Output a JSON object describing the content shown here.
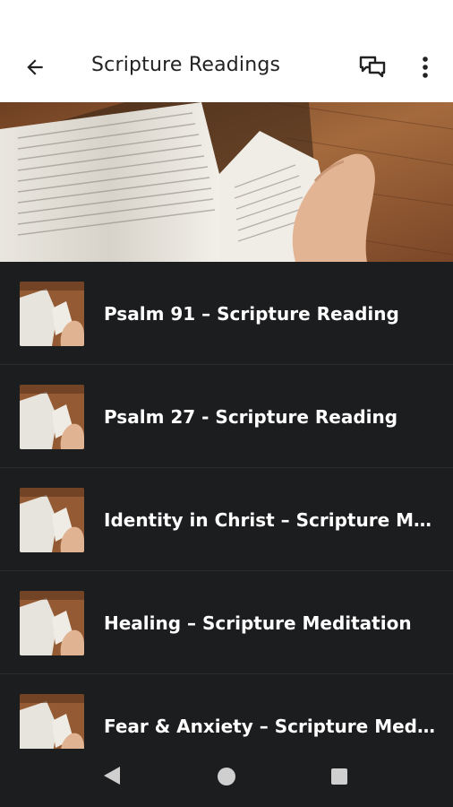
{
  "app_bar": {
    "title": "Scripture Readings",
    "back_icon": "arrow-back-icon",
    "chat_icon": "chat-bubbles-icon",
    "more_icon": "more-vert-icon"
  },
  "list": {
    "items": [
      {
        "title": "Psalm 91 – Scripture Reading"
      },
      {
        "title": "Psalm 27 - Scripture Reading"
      },
      {
        "title": "Identity in Christ – Scripture Meditation"
      },
      {
        "title": "Healing  – Scripture Meditation"
      },
      {
        "title": "Fear & Anxiety – Scripture Meditation"
      }
    ]
  },
  "nav_bar": {
    "back_icon": "nav-back-icon",
    "home_icon": "nav-home-icon",
    "recents_icon": "nav-recents-icon"
  },
  "colors": {
    "app_bar_bg": "#ffffff",
    "list_bg": "#1c1d1f",
    "text_primary": "#ffffff",
    "wood": "#8a5430"
  }
}
